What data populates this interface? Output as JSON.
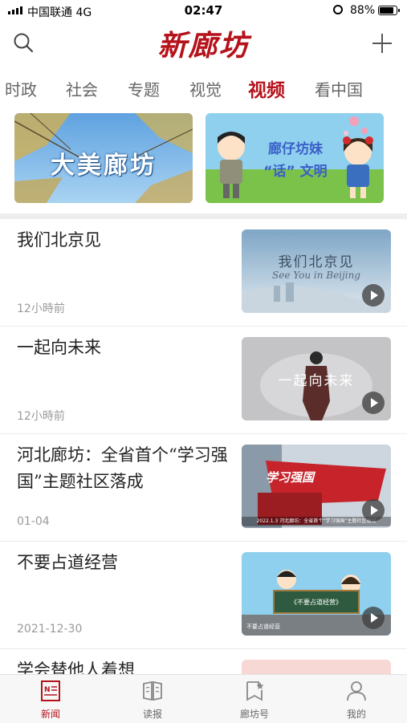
{
  "status_bar": {
    "carrier": "中国联通 4G",
    "time": "02:47",
    "battery": "88%"
  },
  "header": {
    "logo": "新廊坊"
  },
  "tabs": [
    {
      "label": "时政"
    },
    {
      "label": "社会"
    },
    {
      "label": "专题"
    },
    {
      "label": "视觉"
    },
    {
      "label": "视频",
      "active": true
    },
    {
      "label": "看中国"
    }
  ],
  "banners": [
    {
      "text": "大美廊坊"
    },
    {
      "text_line1": "廊仔坊妹",
      "text_line2": "“话” 文明"
    }
  ],
  "news": [
    {
      "title": "我们北京见",
      "time": "12小時前",
      "thumb_title": "我们北京见",
      "thumb_sub": "See You in Beijing"
    },
    {
      "title": "一起向未来",
      "time": "12小時前",
      "thumb_title": "一起向未来"
    },
    {
      "title": "河北廊坊：全省首个“学习强国”主题社区落成",
      "time": "01-04",
      "thumb_title": "学习强国",
      "thumb_caption": "2022.1.3 河北廊坊：全省首个“学习强国”主题社区落成"
    },
    {
      "title": "不要占道经营",
      "time": "2021-12-30",
      "thumb_title": "《不要占道经营》",
      "thumb_caption": "不要占道经营"
    },
    {
      "title": "学会替他人着想",
      "time": ""
    }
  ],
  "bottom_nav": [
    {
      "label": "新闻",
      "active": true
    },
    {
      "label": "读报"
    },
    {
      "label": "廊坊号"
    },
    {
      "label": "我的"
    }
  ],
  "colors": {
    "brand": "#b5121b",
    "tab_inactive": "#666666",
    "meta": "#9a9a9a"
  }
}
